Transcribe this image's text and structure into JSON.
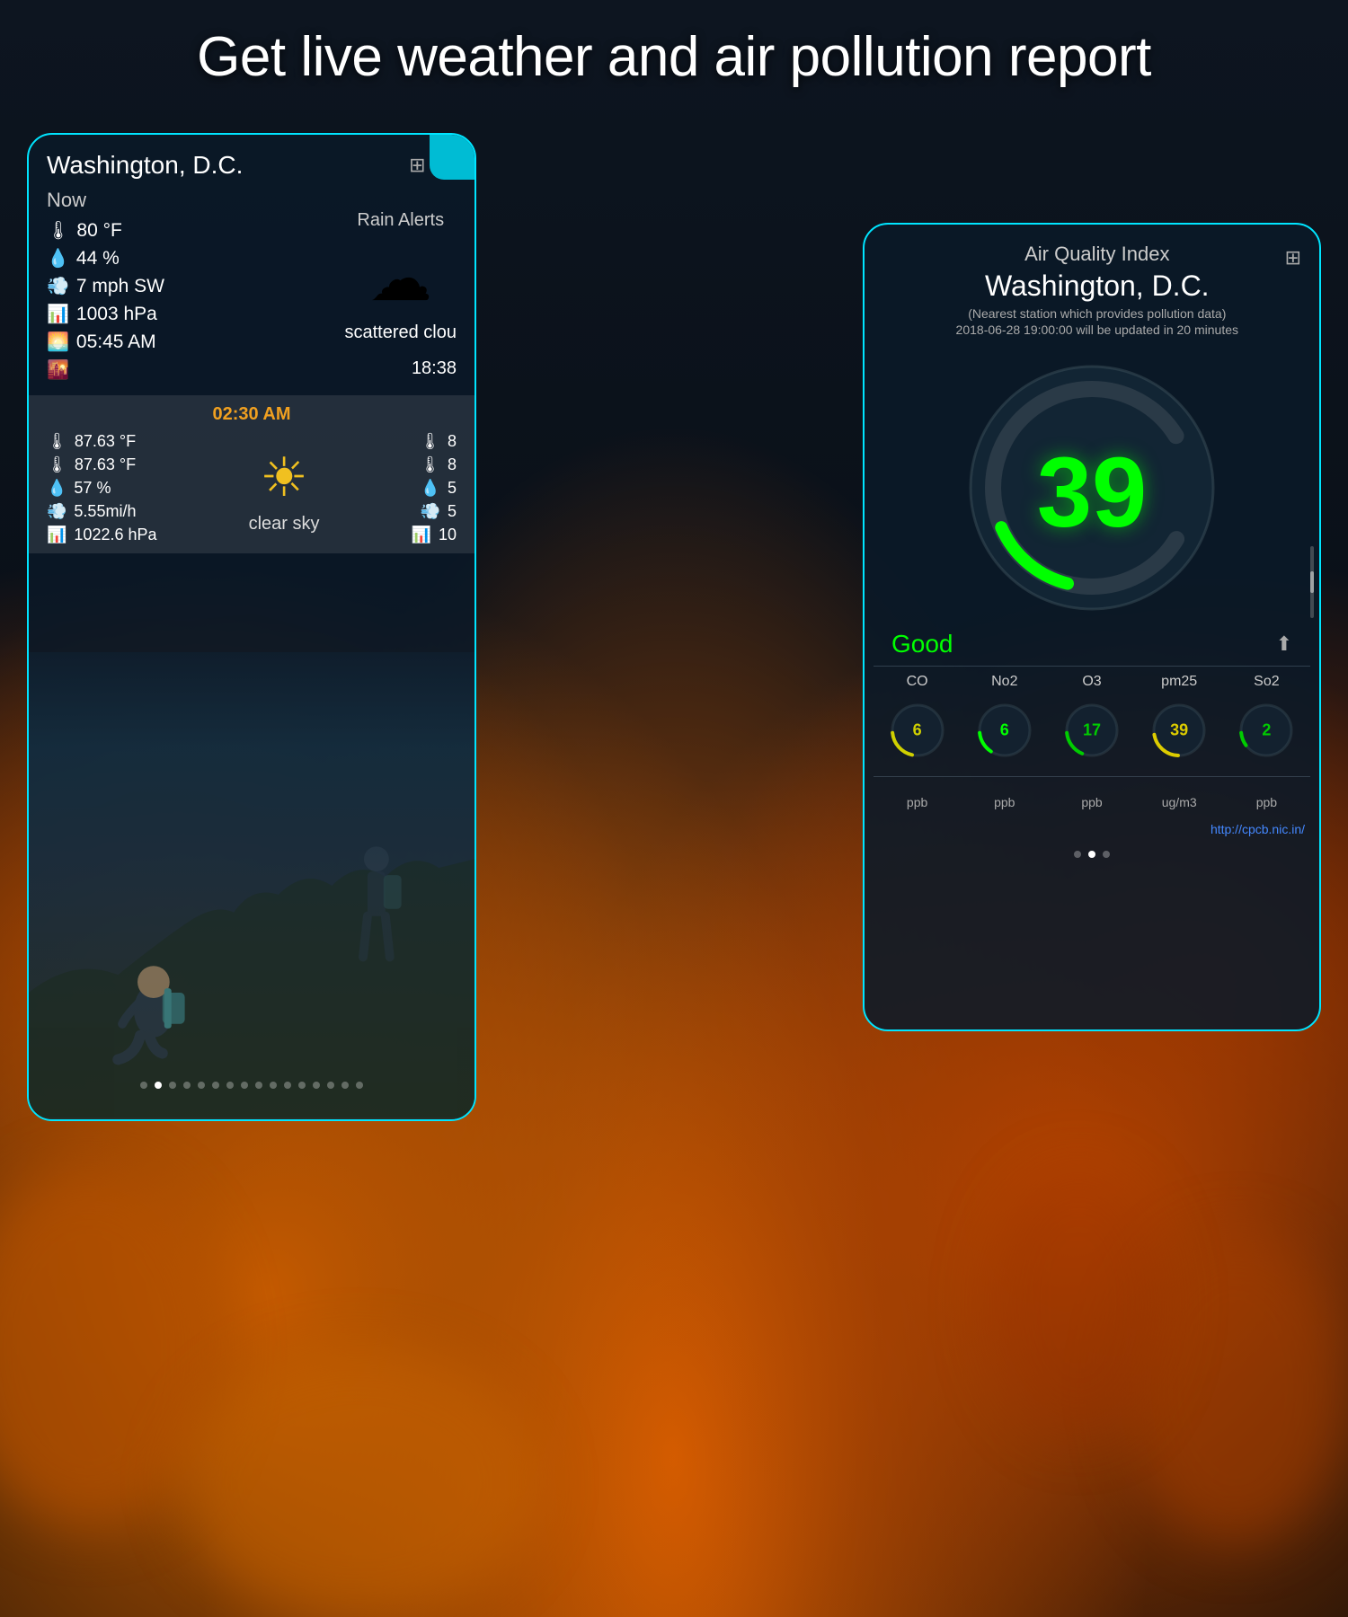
{
  "header": {
    "title": "Get live weather and air pollution report"
  },
  "weather_card": {
    "city": "Washington, D.C.",
    "now_label": "Now",
    "rain_alerts": "Rain Alerts",
    "temperature": "80 °F",
    "humidity": "44 %",
    "wind": "7 mph SW",
    "pressure": "1003 hPa",
    "sunrise": "05:45 AM",
    "sunset": "18:38",
    "condition": "scattered clou",
    "forecast_time": "02:30 AM",
    "forecast_temp_high": "87.63 °F",
    "forecast_temp_low": "87.63 °F",
    "forecast_humidity": "57 %",
    "forecast_wind": "5.55mi/h",
    "forecast_pressure": "1022.6 hPa",
    "forecast_temp_high2": "8",
    "forecast_temp_low2": "8",
    "forecast_humidity2": "5",
    "forecast_wind2": "5",
    "forecast_pressure2": "10",
    "forecast_condition": "clear sky",
    "pagination_dots": 16,
    "active_dot": 1
  },
  "aqi_card": {
    "title": "Air Quality Index",
    "city": "Washington, D.C.",
    "subtitle": "(Nearest station which provides pollution data)",
    "timestamp": "2018-06-28 19:00:00 will be updated in 20 minutes",
    "aqi_value": "39",
    "status": "Good",
    "link": "http://cpcb.nic.in/",
    "pollutants": [
      {
        "name": "CO",
        "value": "6",
        "unit": "ppb",
        "color": "#e0e000",
        "angle": 60
      },
      {
        "name": "No2",
        "value": "6",
        "unit": "ppb",
        "color": "#00ff00",
        "angle": 40
      },
      {
        "name": "O3",
        "value": "17",
        "unit": "ppb",
        "color": "#00cc00",
        "angle": 50
      },
      {
        "name": "pm25",
        "value": "39",
        "unit": "ug/m3",
        "color": "#ddcc00",
        "angle": 55
      },
      {
        "name": "So2",
        "value": "2",
        "unit": "ppb",
        "color": "#00cc00",
        "angle": 20
      }
    ],
    "pagination_dots": 3,
    "active_dot": 2
  },
  "icons": {
    "grid": "⊞",
    "share": "↑",
    "thermometer_hot": "🌡",
    "thermometer": "🌡",
    "droplet": "💧",
    "wind": "💨",
    "pressure": "📊",
    "sun": "🌅",
    "sunset": "🌇",
    "cloud": "☁",
    "sun_clear": "☀"
  }
}
